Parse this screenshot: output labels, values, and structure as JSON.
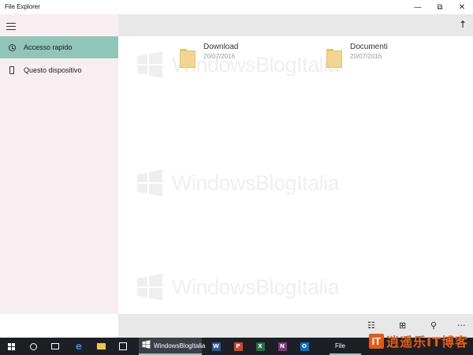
{
  "window": {
    "title": "File Explorer",
    "controls": {
      "minimize": "—",
      "restore": "⧉",
      "close": "✕"
    }
  },
  "sidebar": {
    "items": [
      {
        "label": "Accesso rapido",
        "icon": "clock-icon",
        "active": true
      },
      {
        "label": "Questo dispositivo",
        "icon": "phone-icon",
        "active": false
      }
    ]
  },
  "toolbar": {
    "up_icon": "↑"
  },
  "folders": [
    {
      "name": "Download",
      "date": "20/07/2016"
    },
    {
      "name": "Documenti",
      "date": "20/07/2016"
    }
  ],
  "watermark": {
    "text": "WindowsBlogItalia"
  },
  "appbar": {
    "select_icon": "☷",
    "view_icon": "⊞",
    "search_icon": "⚲",
    "more_icon": "···"
  },
  "taskbar": {
    "active_app_label": "WindowsBlogItalia",
    "file_label": "File",
    "apps": [
      {
        "name": "edge",
        "letter": "e",
        "color": "#2f86d6"
      },
      {
        "name": "file-explorer",
        "letter": "",
        "color": "#f3c64a"
      },
      {
        "name": "store",
        "letter": "",
        "color": "#ffffff"
      },
      {
        "name": "word",
        "letter": "W",
        "color": "#2b5797"
      },
      {
        "name": "powerpoint",
        "letter": "P",
        "color": "#d24726"
      },
      {
        "name": "excel",
        "letter": "X",
        "color": "#1f7244"
      },
      {
        "name": "onenote",
        "letter": "N",
        "color": "#80397b"
      },
      {
        "name": "outlook",
        "letter": "O",
        "color": "#0072c6"
      }
    ]
  },
  "brand": {
    "it": "IT",
    "text": "逍遥乐IT博客"
  },
  "colors": {
    "accent": "#8fc6b8",
    "sidebar_bg": "#f7eef2",
    "toolbar_bg": "#e8e8e8",
    "taskbar_bg": "#1c1f26",
    "brand": "#e55b13"
  }
}
